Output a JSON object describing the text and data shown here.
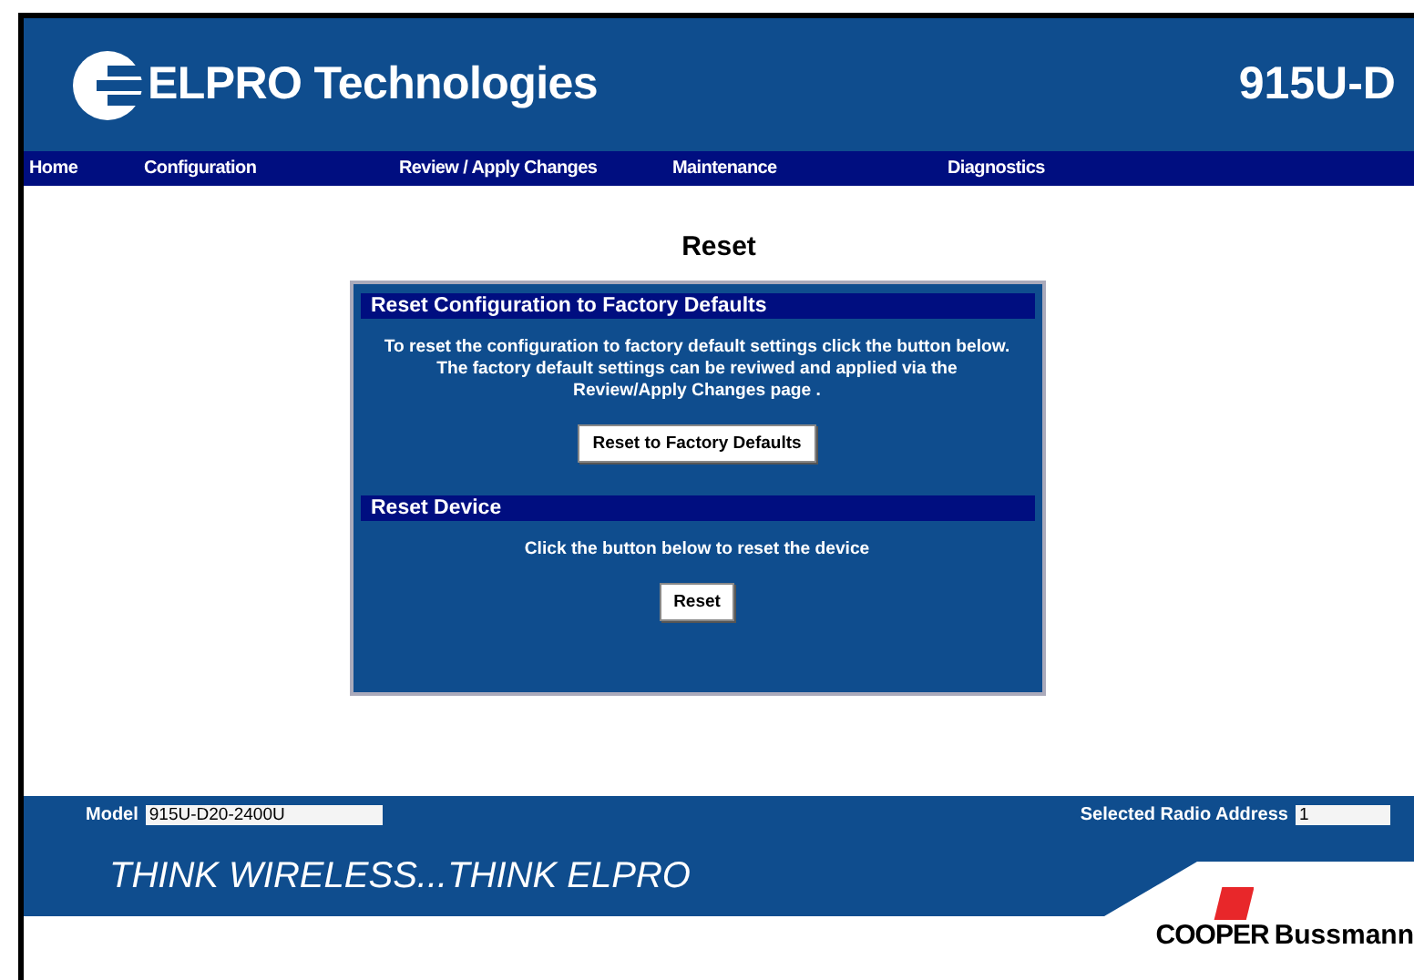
{
  "header": {
    "brand": "ELPRO Technologies",
    "model": "915U-D"
  },
  "nav": [
    {
      "label": "Home"
    },
    {
      "label": "Configuration"
    },
    {
      "label": "Review / Apply Changes"
    },
    {
      "label": "Maintenance"
    },
    {
      "label": "Diagnostics"
    }
  ],
  "page_title": "Reset",
  "sections": [
    {
      "title": "Reset Configuration to Factory Defaults",
      "text_lines": [
        "To reset the configuration to factory default settings click the button below.",
        "The factory default settings can be reviwed and applied via the",
        "Review/Apply Changes page ."
      ],
      "button": "Reset to Factory Defaults"
    },
    {
      "title": "Reset Device",
      "text_lines": [
        "Click the button below to reset the device"
      ],
      "button": "Reset"
    }
  ],
  "status": {
    "model_label": "Model",
    "model_value": "915U-D20-2400U",
    "address_label": "Selected Radio Address",
    "address_value": "1"
  },
  "footer": {
    "slogan": "THINK WIRELESS...THINK ELPRO",
    "maker_bold": "COOPER",
    "maker_rest": "Bussmann"
  }
}
